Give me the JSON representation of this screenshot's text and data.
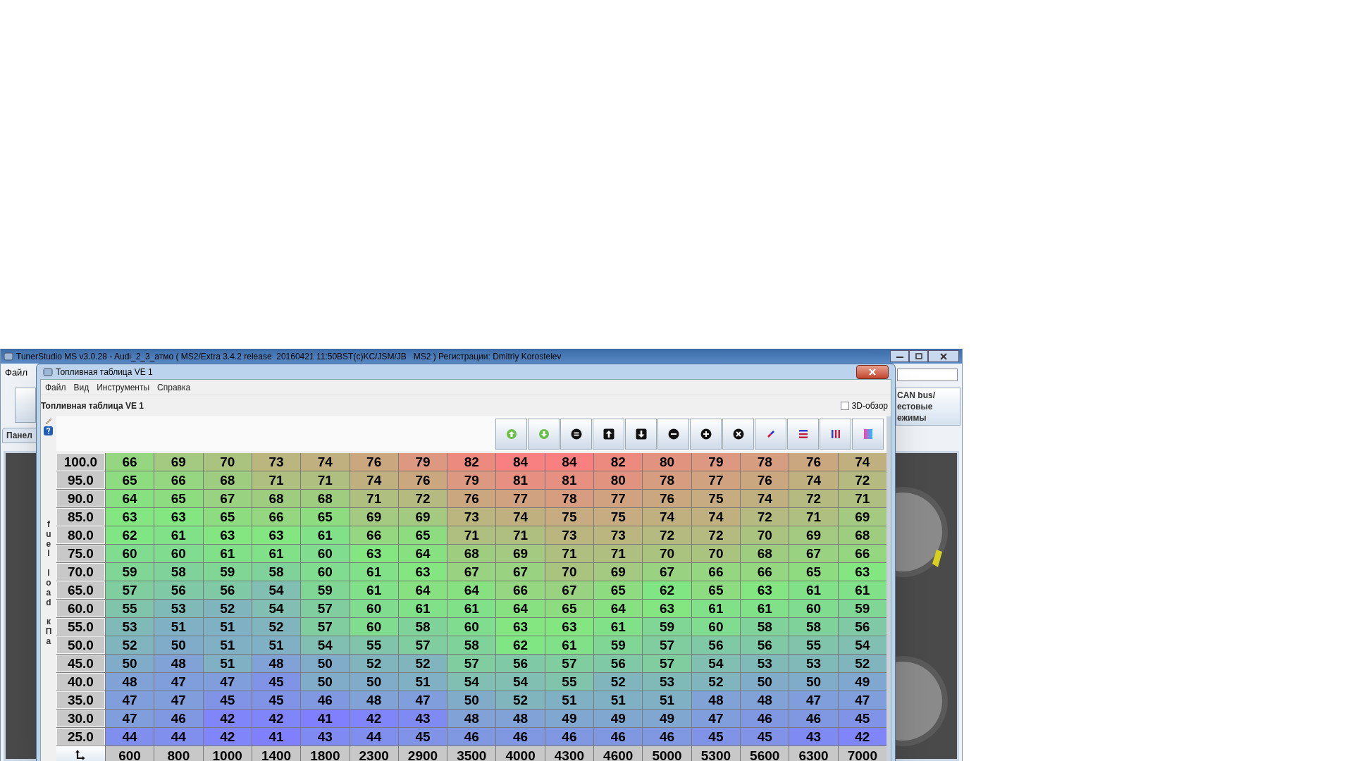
{
  "window": {
    "title": "TunerStudio MS v3.0.28 - Audi_2_3_атмо ( MS2/Extra 3.4.2 release  20160421 11:50BST(c)KC/JSM/JB   MS2 ) Регистрации: Dmitriy Korostelev"
  },
  "main_menu": [
    "Файл"
  ],
  "main_tab": {
    "label": "Панел"
  },
  "side_button": {
    "label": "CAN bus/\nестовые\nежимы"
  },
  "dialog": {
    "title": "Топливная таблица VE 1",
    "menu": [
      "Файл",
      "Вид",
      "Инструменты",
      "Справка"
    ],
    "heading": "Топливная таблица VE 1",
    "view_3d": {
      "label": "3D-обзор",
      "checked": false
    }
  },
  "table": {
    "y_axis_label": [
      "fuel",
      "load",
      "кПа"
    ],
    "rows": [
      {
        "load": "100.0",
        "values": [
          "66",
          "69",
          "70",
          "73",
          "74",
          "76",
          "79",
          "82",
          "84",
          "84",
          "82",
          "80",
          "79",
          "78",
          "76",
          "74"
        ]
      },
      {
        "load": "95.0",
        "values": [
          "65",
          "66",
          "68",
          "71",
          "71",
          "74",
          "76",
          "79",
          "81",
          "81",
          "80",
          "78",
          "77",
          "76",
          "74",
          "72"
        ]
      },
      {
        "load": "90.0",
        "values": [
          "64",
          "65",
          "67",
          "68",
          "68",
          "71",
          "72",
          "76",
          "77",
          "78",
          "77",
          "76",
          "75",
          "74",
          "72",
          "71"
        ]
      },
      {
        "load": "85.0",
        "values": [
          "63",
          "63",
          "65",
          "66",
          "65",
          "69",
          "69",
          "73",
          "74",
          "75",
          "75",
          "74",
          "74",
          "72",
          "71",
          "69"
        ]
      },
      {
        "load": "80.0",
        "values": [
          "62",
          "61",
          "63",
          "63",
          "61",
          "66",
          "65",
          "71",
          "71",
          "73",
          "73",
          "72",
          "72",
          "70",
          "69",
          "68"
        ]
      },
      {
        "load": "75.0",
        "values": [
          "60",
          "60",
          "61",
          "61",
          "60",
          "63",
          "64",
          "68",
          "69",
          "71",
          "71",
          "70",
          "70",
          "68",
          "67",
          "66"
        ]
      },
      {
        "load": "70.0",
        "values": [
          "59",
          "58",
          "59",
          "58",
          "60",
          "61",
          "63",
          "67",
          "67",
          "70",
          "69",
          "67",
          "66",
          "66",
          "65",
          "63"
        ]
      },
      {
        "load": "65.0",
        "values": [
          "57",
          "56",
          "56",
          "54",
          "59",
          "61",
          "64",
          "64",
          "66",
          "67",
          "65",
          "62",
          "65",
          "63",
          "61",
          "61"
        ]
      },
      {
        "load": "60.0",
        "values": [
          "55",
          "53",
          "52",
          "54",
          "57",
          "60",
          "61",
          "61",
          "64",
          "65",
          "64",
          "63",
          "61",
          "61",
          "60",
          "59"
        ]
      },
      {
        "load": "55.0",
        "values": [
          "53",
          "51",
          "51",
          "52",
          "57",
          "60",
          "58",
          "60",
          "63",
          "63",
          "61",
          "59",
          "60",
          "58",
          "58",
          "56"
        ]
      },
      {
        "load": "50.0",
        "values": [
          "52",
          "50",
          "51",
          "51",
          "54",
          "55",
          "57",
          "58",
          "62",
          "61",
          "59",
          "57",
          "56",
          "56",
          "55",
          "54"
        ]
      },
      {
        "load": "45.0",
        "values": [
          "50",
          "48",
          "51",
          "48",
          "50",
          "52",
          "52",
          "57",
          "56",
          "57",
          "56",
          "57",
          "54",
          "53",
          "53",
          "52"
        ]
      },
      {
        "load": "40.0",
        "values": [
          "48",
          "47",
          "47",
          "45",
          "50",
          "50",
          "51",
          "54",
          "54",
          "55",
          "52",
          "53",
          "52",
          "50",
          "50",
          "49"
        ]
      },
      {
        "load": "35.0",
        "values": [
          "47",
          "47",
          "45",
          "45",
          "46",
          "48",
          "47",
          "50",
          "52",
          "51",
          "51",
          "51",
          "48",
          "48",
          "47",
          "47"
        ]
      },
      {
        "load": "30.0",
        "values": [
          "47",
          "46",
          "42",
          "42",
          "41",
          "42",
          "43",
          "48",
          "48",
          "49",
          "49",
          "49",
          "47",
          "46",
          "46",
          "45"
        ]
      },
      {
        "load": "25.0",
        "values": [
          "44",
          "44",
          "42",
          "41",
          "43",
          "44",
          "45",
          "46",
          "46",
          "46",
          "46",
          "46",
          "45",
          "45",
          "43",
          "42"
        ]
      }
    ],
    "rpm": [
      "600",
      "800",
      "1000",
      "1400",
      "1800",
      "2300",
      "2900",
      "3500",
      "4000",
      "4300",
      "4600",
      "5000",
      "5300",
      "5600",
      "6300",
      "7000"
    ]
  }
}
